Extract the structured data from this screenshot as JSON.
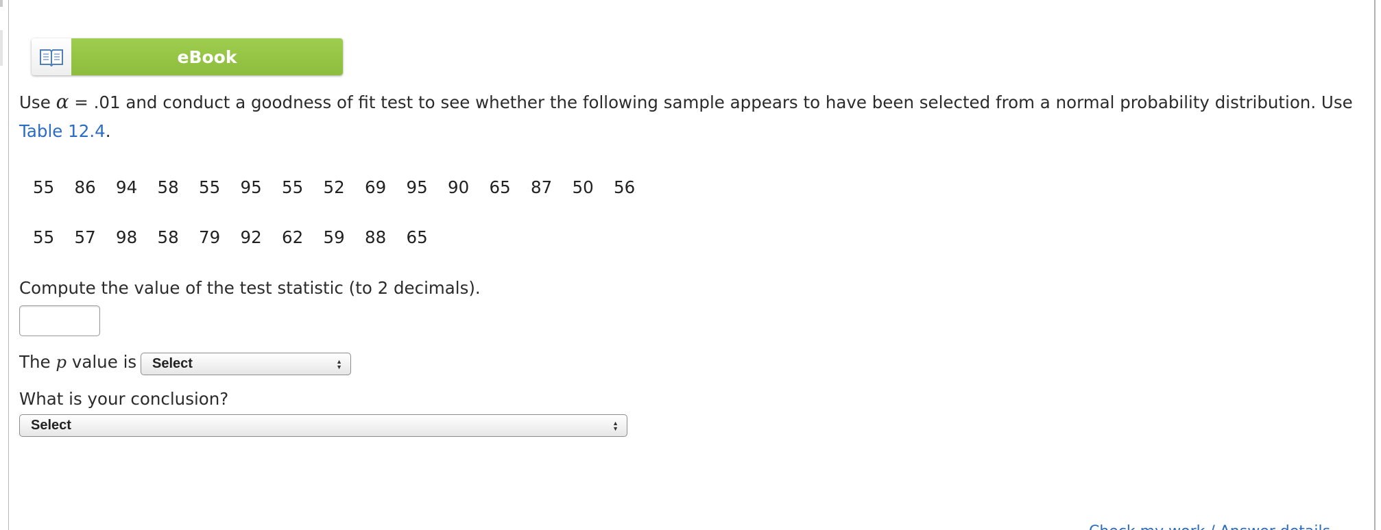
{
  "ebook": {
    "label": "eBook",
    "icon": "open-book-icon",
    "accent_color": "#95c545"
  },
  "question": {
    "intro": "Use",
    "alpha_symbol": "α",
    "equals": "=",
    "rest": ".01 and conduct a goodness of fit test to see whether the following sample appears to have been selected from a normal probability distribution. Use",
    "table_link": "Table 12.4",
    "period": "."
  },
  "sample": {
    "row1": [
      "55",
      "86",
      "94",
      "58",
      "55",
      "95",
      "55",
      "52",
      "69",
      "95",
      "90",
      "65",
      "87",
      "50",
      "56"
    ],
    "row2": [
      "55",
      "57",
      "98",
      "58",
      "79",
      "92",
      "62",
      "59",
      "88",
      "65"
    ]
  },
  "test_statistic": {
    "prompt": "Compute the value of the test statistic (to 2 decimals).",
    "value": ""
  },
  "p_value": {
    "prefix": "The",
    "variable": "p",
    "suffix": "value is",
    "selected": "Select"
  },
  "conclusion": {
    "prompt": "What is your conclusion?",
    "selected": "Select"
  },
  "footer": {
    "partial_link": "Check my work / Answer details"
  },
  "colors": {
    "link": "#2a6cc4",
    "text": "#2b2b2b"
  }
}
